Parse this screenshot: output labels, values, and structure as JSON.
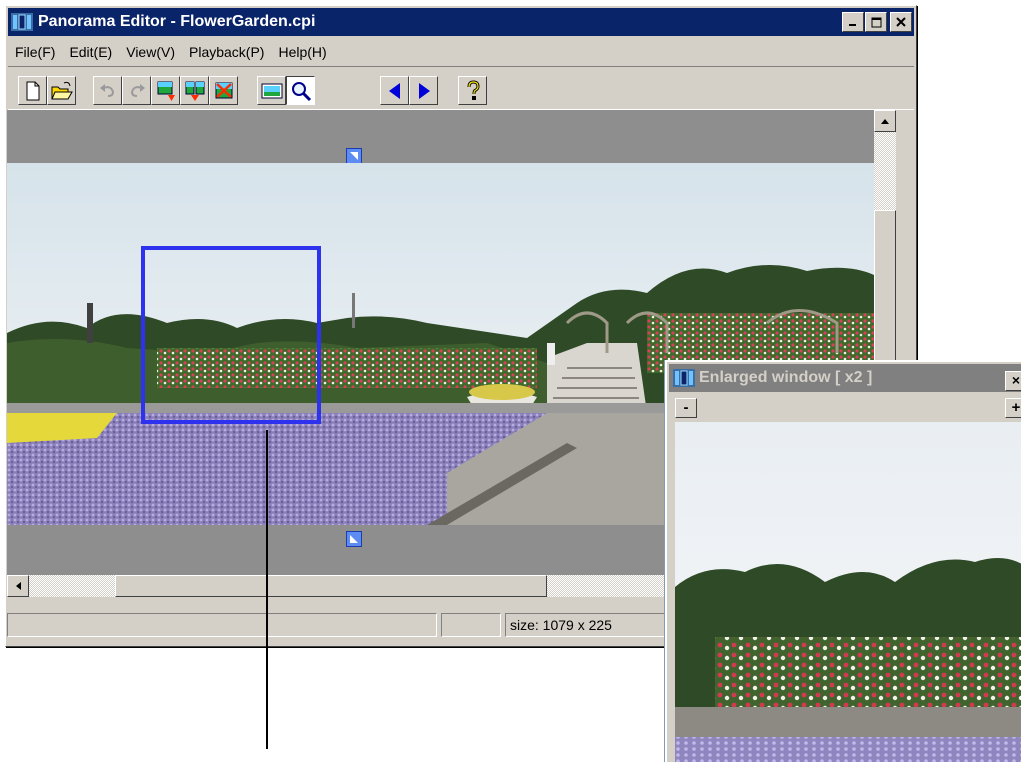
{
  "main_window": {
    "title": "Panorama Editor - FlowerGarden.cpi",
    "caption_buttons": [
      "minimize",
      "maximize",
      "close"
    ],
    "menu": [
      "File(F)",
      "Edit(E)",
      "View(V)",
      "Playback(P)",
      "Help(H)"
    ],
    "toolbar": [
      {
        "icon": "new-document-icon",
        "state": "enabled"
      },
      {
        "icon": "open-folder-icon",
        "state": "enabled"
      },
      {
        "icon": "undo-icon",
        "state": "disabled"
      },
      {
        "icon": "redo-icon",
        "state": "disabled"
      },
      {
        "icon": "insert-image-icon",
        "state": "enabled"
      },
      {
        "icon": "split-image-icon",
        "state": "enabled"
      },
      {
        "icon": "delete-image-icon",
        "state": "enabled"
      },
      {
        "icon": "view-panorama-icon",
        "state": "enabled"
      },
      {
        "icon": "magnifier-icon",
        "state": "pressed"
      },
      {
        "icon": "scroll-left-icon",
        "state": "enabled"
      },
      {
        "icon": "scroll-right-icon",
        "state": "enabled"
      },
      {
        "icon": "help-icon",
        "state": "enabled"
      }
    ],
    "status": {
      "pane1": "",
      "pane2": "",
      "size_text": "size: 1079 x 225"
    }
  },
  "enlarged_window": {
    "title": "Enlarged window [ x2 ]",
    "active": false,
    "zoom_out_label": "-",
    "zoom_in_label": "+",
    "close_label": "×"
  },
  "colors": {
    "title_active": "#0a246a",
    "title_inactive": "#808080",
    "selection_box": "#2e32ee",
    "marker": "#5c8cf2",
    "workspace_gray": "#8e8e8e"
  }
}
